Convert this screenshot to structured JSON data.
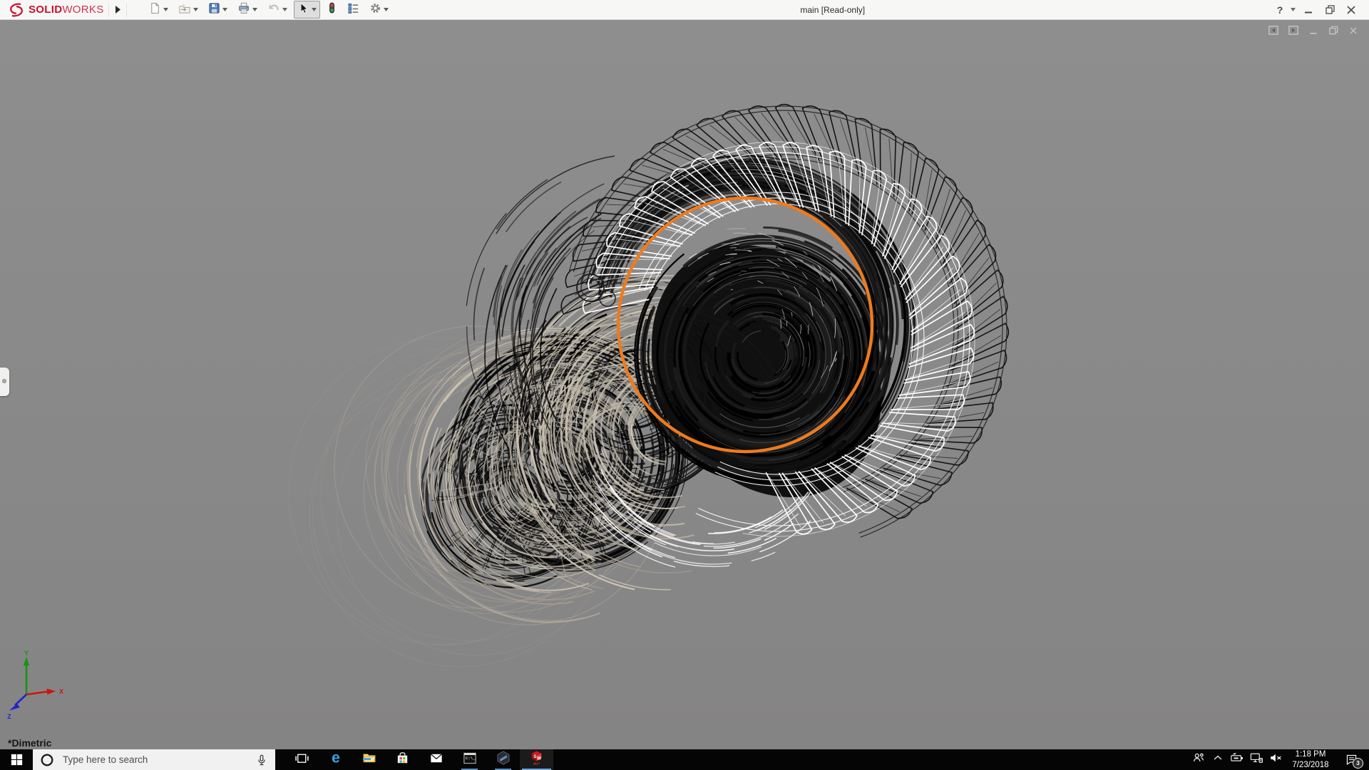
{
  "titlebar": {
    "brand": {
      "word_bold": "SOLID",
      "word_light": "WORKS",
      "color": "#c8102e"
    },
    "document_title": "main [Read-only]",
    "help_label": "?",
    "toolbar": [
      {
        "icon": "new-document-icon",
        "dropdown": true,
        "selected": false,
        "disabled": false
      },
      {
        "icon": "open-folder-icon",
        "dropdown": true,
        "selected": false,
        "disabled": false
      },
      {
        "icon": "save-icon",
        "dropdown": true,
        "selected": false,
        "disabled": false
      },
      {
        "icon": "print-icon",
        "dropdown": true,
        "selected": false,
        "disabled": false
      },
      {
        "icon": "undo-icon",
        "dropdown": true,
        "selected": false,
        "disabled": true
      },
      {
        "icon": "select-cursor-icon",
        "dropdown": true,
        "selected": true,
        "disabled": false
      },
      {
        "icon": "rebuild-traffic-light-icon",
        "dropdown": false,
        "selected": false,
        "disabled": false
      },
      {
        "icon": "file-properties-icon",
        "dropdown": false,
        "selected": false,
        "disabled": false
      },
      {
        "icon": "options-gear-icon",
        "dropdown": true,
        "selected": false,
        "disabled": false
      }
    ],
    "window_controls": [
      "minimize-icon",
      "restore-icon",
      "close-icon"
    ]
  },
  "viewport": {
    "background_color": "#8a8a8a",
    "selection_color": "#ee7b1e",
    "view_orientation_label": "*Dimetric",
    "document_controls": [
      "show-left-pane-icon",
      "show-right-pane-icon",
      "doc-minimize-icon",
      "doc-restore-icon",
      "doc-close-icon"
    ],
    "triad": {
      "x_label": "X",
      "y_label": "Y",
      "z_label": "Z",
      "x_color": "#cc1414",
      "y_color": "#169416",
      "z_color": "#2222cc"
    }
  },
  "taskbar": {
    "search": {
      "placeholder": "Type here to search"
    },
    "apps": [
      {
        "icon": "task-view-icon",
        "running": false,
        "active": false
      },
      {
        "icon": "edge-icon",
        "running": false,
        "active": false
      },
      {
        "icon": "file-explorer-icon",
        "running": false,
        "active": false
      },
      {
        "icon": "store-icon",
        "running": false,
        "active": false
      },
      {
        "icon": "mail-icon",
        "running": false,
        "active": false
      },
      {
        "icon": "cmd-icon",
        "running": true,
        "active": false
      },
      {
        "icon": "hexagon-app-icon",
        "running": true,
        "active": false
      },
      {
        "icon": "solidworks-2017-icon",
        "running": true,
        "active": true
      }
    ],
    "tray": {
      "icons": [
        "people-icon",
        "chevron-up-icon",
        "battery-icon",
        "network-icon",
        "volume-muted-icon"
      ],
      "time": "1:18 PM",
      "date": "7/23/2018",
      "notification_count": "3"
    }
  }
}
